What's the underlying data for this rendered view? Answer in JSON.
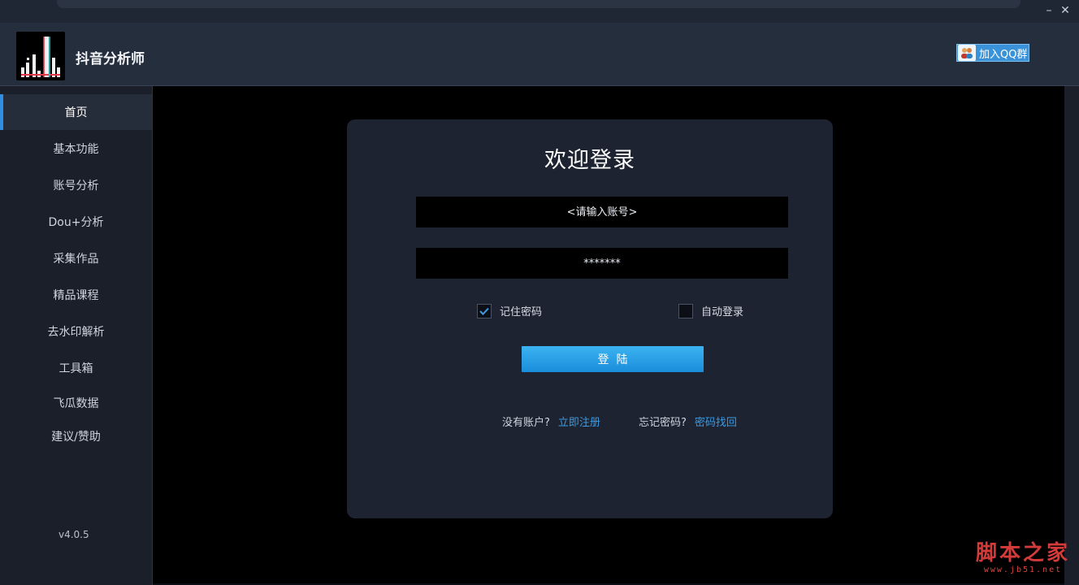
{
  "app": {
    "title": "抖音分析师",
    "version": "v4.0.5"
  },
  "header": {
    "qq_button": "加入QQ群"
  },
  "window": {
    "minimize": "–",
    "close": "✕"
  },
  "sidebar": {
    "items": [
      {
        "label": "首页",
        "active": true
      },
      {
        "label": "基本功能"
      },
      {
        "label": "账号分析"
      },
      {
        "label": "Dou+分析"
      },
      {
        "label": "采集作品"
      },
      {
        "label": "精品课程"
      },
      {
        "label": "去水印解析"
      },
      {
        "label": "工具箱"
      },
      {
        "label": "飞瓜数据"
      },
      {
        "label": "建议/赞助"
      }
    ]
  },
  "login": {
    "title": "欢迎登录",
    "account_placeholder": "<请输入账号>",
    "password_value": "*******",
    "remember_label": "记住密码",
    "remember_checked": true,
    "auto_login_label": "自动登录",
    "auto_login_checked": false,
    "submit_label": "登  陆",
    "no_account_text": "没有账户?",
    "register_link": "立即注册",
    "forgot_text": "忘记密码?",
    "recover_link": "密码找回"
  },
  "watermark": {
    "text": "脚本之家",
    "url": "www.jb51.net"
  },
  "colors": {
    "accent": "#2f8de4",
    "link": "#3c9be4",
    "button": "#1a8ddb",
    "watermark": "#d33a3a"
  }
}
